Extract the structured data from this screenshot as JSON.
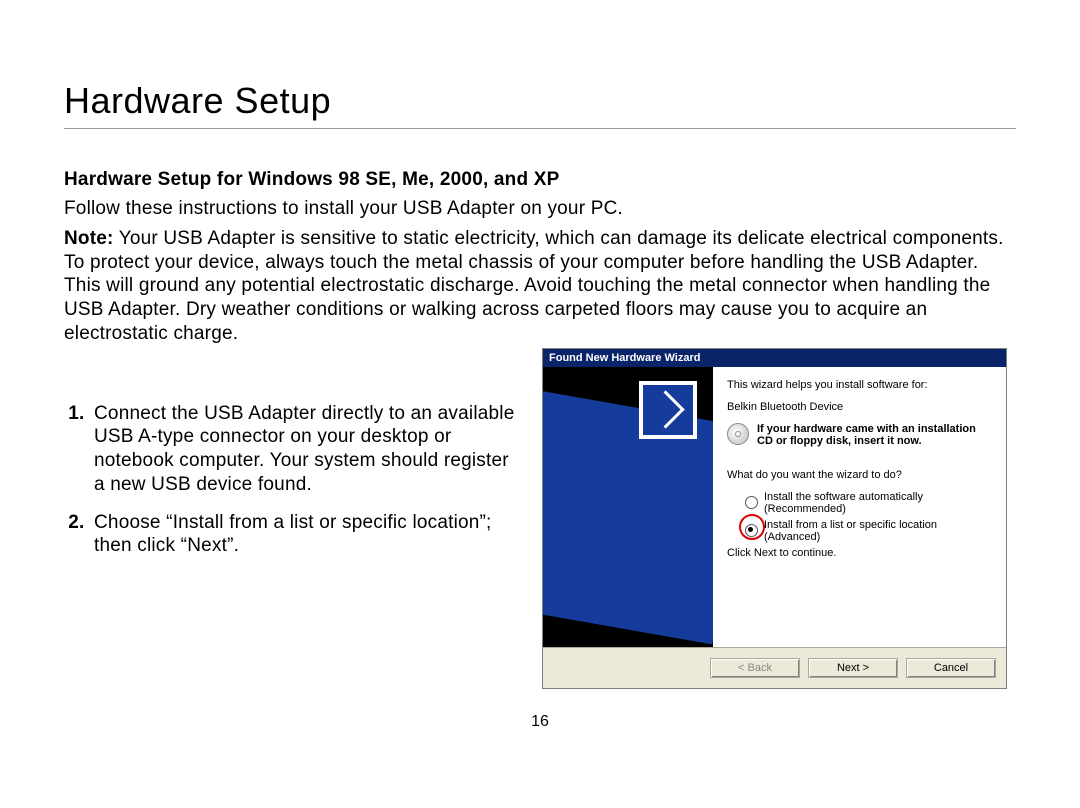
{
  "page": {
    "title": "Hardware Setup",
    "subhead": "Hardware Setup for Windows 98 SE, Me, 2000, and XP",
    "intro": "Follow these instructions to install your USB Adapter on your PC.",
    "note_label": "Note:",
    "note_body": " Your USB Adapter is sensitive to static electricity, which can damage its delicate electrical components. To protect your device, always touch the metal chassis of your computer before handling the USB Adapter. This will ground any potential electrostatic discharge. Avoid touching the metal connector when handling the USB Adapter. Dry weather conditions or walking across carpeted floors may cause you to acquire an electrostatic charge.",
    "steps": [
      "Connect the USB Adapter directly to an available USB A-type connector on your desktop or notebook computer. Your system should register a new USB device found.",
      "Choose “Install from a list or specific location”; then click “Next”."
    ],
    "page_number": "16"
  },
  "wizard": {
    "title": "Found New Hardware Wizard",
    "line1": "This wizard helps you install software for:",
    "device": "Belkin Bluetooth Device",
    "cd_hint": "If your hardware came with an installation CD or floppy disk, insert it now.",
    "question": "What do you want the wizard to do?",
    "opt_auto": "Install the software automatically (Recommended)",
    "opt_list": "Install from a list or specific location (Advanced)",
    "continue": "Click Next to continue.",
    "btn_back": "< Back",
    "btn_next": "Next >",
    "btn_cancel": "Cancel"
  }
}
